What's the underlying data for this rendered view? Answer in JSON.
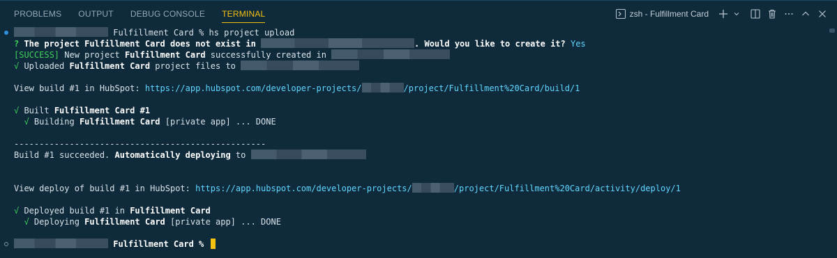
{
  "tabs": [
    {
      "label": "PROBLEMS"
    },
    {
      "label": "OUTPUT"
    },
    {
      "label": "DEBUG CONSOLE"
    },
    {
      "label": "TERMINAL",
      "active": true
    }
  ],
  "toolbar": {
    "terminal_name": "zsh - Fulfillment Card",
    "icons": [
      "terminal-icon",
      "plus-icon",
      "chevron-down-icon",
      "split-icon",
      "trash-icon",
      "more-icon",
      "chevron-up-icon",
      "close-icon"
    ]
  },
  "colors": {
    "accent": "#f5c211",
    "background": "#0f2a3b",
    "success": "#3fd15a",
    "link": "#5fd7ff",
    "status_dot": "#2f8fdc"
  },
  "terminal": {
    "prompt": "Fulfillment Card %",
    "command": " hs project upload",
    "q_mark": "?",
    "q_text1": " The project Fulfillment Card does not exist in ",
    "q_text2": ". Would you like to create it? ",
    "q_answer": "Yes",
    "success_tag": "[SUCCESS]",
    "success_1": " New project ",
    "success_name": "Fulfillment Card",
    "success_2": " successfully created in ",
    "check": "√",
    "uploaded_1": " Uploaded ",
    "uploaded_name": "Fulfillment Card",
    "uploaded_2": " project files to ",
    "viewbuild_1": "View build #1 in HubSpot: ",
    "viewbuild_url1": "https://app.hubspot.com/developer-projects/",
    "viewbuild_url2": "/project/Fulfillment%20Card/build/1",
    "built_1": " Built ",
    "built_name": "Fulfillment Card",
    "built_2": " #1",
    "building_1": " Building ",
    "building_name": "Fulfillment Card",
    "building_2": " [private app] ... DONE",
    "divider": "--------------------------------------------------",
    "succeeded_1": "Build #1 succeeded. ",
    "succeeded_bold": "Automatically deploying",
    "succeeded_2": " to ",
    "viewdeploy_1": "View deploy of build #1 in HubSpot: ",
    "viewdeploy_url1": "https://app.hubspot.com/developer-projects/",
    "viewdeploy_url2": "/project/Fulfillment%20Card/activity/deploy/1",
    "deployed_1": " Deployed build #1 in ",
    "deployed_name": "Fulfillment Card",
    "deploying_1": " Deploying ",
    "deploying_name": "Fulfillment Card",
    "deploying_2": " [private app] ... DONE",
    "prompt_end": "Fulfillment Card %"
  }
}
